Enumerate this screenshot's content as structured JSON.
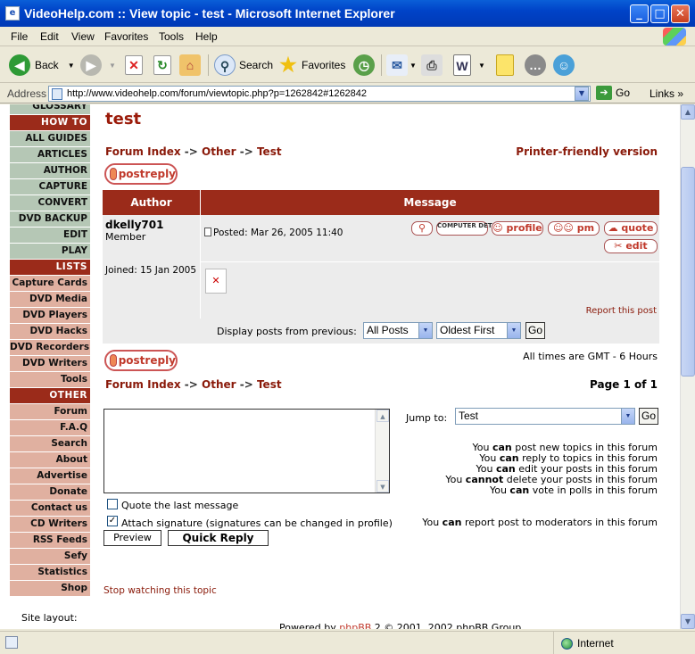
{
  "window": {
    "title": "VideoHelp.com :: View topic - test - Microsoft Internet Explorer",
    "buttons": {
      "minimize": "_",
      "maximize": "□",
      "close": "✕"
    }
  },
  "menu": {
    "items": [
      "File",
      "Edit",
      "View",
      "Favorites",
      "Tools",
      "Help"
    ]
  },
  "toolbar": {
    "back": "Back",
    "search": "Search",
    "favorites": "Favorites"
  },
  "address": {
    "label": "Address",
    "url": "http://www.videohelp.com/forum/viewtopic.php?p=1262842#1262842",
    "go": "Go",
    "links": "Links"
  },
  "nav": {
    "items": [
      {
        "label": "GLOSSARY",
        "style": "green"
      },
      {
        "label": "HOW TO",
        "style": "head"
      },
      {
        "label": "ALL GUIDES",
        "style": "green"
      },
      {
        "label": "ARTICLES",
        "style": "green"
      },
      {
        "label": "AUTHOR",
        "style": "green"
      },
      {
        "label": "CAPTURE",
        "style": "green"
      },
      {
        "label": "CONVERT",
        "style": "green"
      },
      {
        "label": "DVD BACKUP",
        "style": "green"
      },
      {
        "label": "EDIT",
        "style": "green"
      },
      {
        "label": "PLAY",
        "style": "green"
      },
      {
        "label": "LISTS",
        "style": "head"
      },
      {
        "label": "Capture Cards",
        "style": "pink"
      },
      {
        "label": "DVD Media",
        "style": "pink"
      },
      {
        "label": "DVD Players",
        "style": "pink"
      },
      {
        "label": "DVD Hacks",
        "style": "pink"
      },
      {
        "label": "DVD Recorders",
        "style": "pink"
      },
      {
        "label": "DVD Writers",
        "style": "pink"
      },
      {
        "label": "Tools",
        "style": "pink"
      },
      {
        "label": "OTHER",
        "style": "head"
      },
      {
        "label": "Forum",
        "style": "pink"
      },
      {
        "label": "F.A.Q",
        "style": "pink"
      },
      {
        "label": "Search",
        "style": "pink"
      },
      {
        "label": "About",
        "style": "pink"
      },
      {
        "label": "Advertise",
        "style": "pink"
      },
      {
        "label": "Donate",
        "style": "pink"
      },
      {
        "label": "Contact us",
        "style": "pink"
      },
      {
        "label": "CD Writers",
        "style": "pink"
      },
      {
        "label": "RSS Feeds",
        "style": "pink"
      },
      {
        "label": "Sefy",
        "style": "pink"
      },
      {
        "label": "Statistics",
        "style": "pink"
      },
      {
        "label": "Shop",
        "style": "pink"
      }
    ]
  },
  "topic": {
    "title": "test",
    "breadcrumb": {
      "index": "Forum Index",
      "sep": "->",
      "category": "Other",
      "forum": "Test"
    },
    "printer_friendly": "Printer-friendly version",
    "postreply": "postreply"
  },
  "table": {
    "author_header": "Author",
    "message_header": "Message"
  },
  "post": {
    "username": "dkelly701",
    "rank": "Member",
    "joined": "Joined: 15 Jan 2005",
    "posted": "Posted: Mar 26, 2005 11:40",
    "buttons": {
      "computer": "COMPUTER DETAILS",
      "profile": "profile",
      "pm": "pm",
      "quote": "quote",
      "edit": "edit"
    },
    "report": "Report this post",
    "broken_image": "✕"
  },
  "display": {
    "label": "Display posts from previous:",
    "posts_value": "All Posts",
    "order_value": "Oldest First",
    "go": "Go"
  },
  "times": "All times are GMT - 6 Hours",
  "page_of": "Page 1 of 1",
  "quick_reply": {
    "quote_label": "Quote the last message",
    "quote_checked": "",
    "signature_label": "Attach signature (signatures can be changed in profile)",
    "signature_checked": "✓",
    "preview": "Preview",
    "quick_reply": "Quick Reply"
  },
  "jump": {
    "label": "Jump to:",
    "value": "Test",
    "go": "Go"
  },
  "permissions": [
    {
      "pre": "You ",
      "bold": "can",
      "post": " post new topics in this forum"
    },
    {
      "pre": "You ",
      "bold": "can",
      "post": " reply to topics in this forum"
    },
    {
      "pre": "You ",
      "bold": "can",
      "post": " edit your posts in this forum"
    },
    {
      "pre": "You ",
      "bold": "cannot",
      "post": " delete your posts in this forum"
    },
    {
      "pre": "You ",
      "bold": "can",
      "post": " vote in polls in this forum"
    },
    {
      "pre": "You ",
      "bold": "can",
      "post": " report post to moderators in this forum"
    }
  ],
  "stop_watching": "Stop watching this topic",
  "site_layout": "Site layout:",
  "powered": {
    "pre": "Powered by ",
    "link": "phpBB",
    "post": " 2 © 2001, 2002 phpBB Group"
  },
  "status": {
    "zone": "Internet"
  },
  "colors": {
    "nav_head": "#9b2b1a",
    "nav_green": "#b5c7b5",
    "nav_pink": "#e0b0a0",
    "maroon": "#8a1a0a"
  }
}
